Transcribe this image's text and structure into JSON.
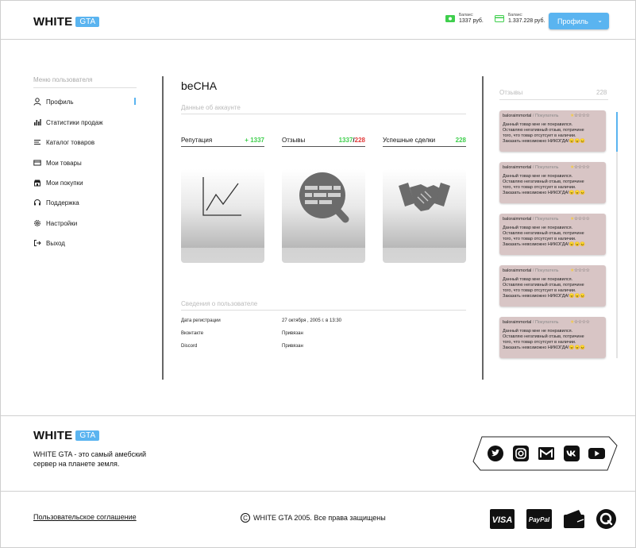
{
  "header": {
    "logo_main": "WHITE",
    "logo_tag": "GTA",
    "balances": [
      {
        "label": "Баланс:",
        "value": "1337 руб.",
        "icon": "cash-icon",
        "color": "#3fcf4d"
      },
      {
        "label": "Баланс:",
        "value": "1.337.228 руб.",
        "icon": "card-icon",
        "color": "#3fcf4d"
      }
    ],
    "profile_button": "Профиль"
  },
  "sidebar": {
    "title": "Меню пользователя",
    "items": [
      {
        "label": "Профиль",
        "icon": "user-icon",
        "active": true
      },
      {
        "label": "Статистики продаж",
        "icon": "bar-chart-icon"
      },
      {
        "label": "Каталог товаров",
        "icon": "list-icon"
      },
      {
        "label": "Мои товары",
        "icon": "card-icon"
      },
      {
        "label": "Мои покупки",
        "icon": "store-icon"
      },
      {
        "label": "Поддержка",
        "icon": "headset-icon"
      },
      {
        "label": "Настройки",
        "icon": "gear-icon"
      },
      {
        "label": "Выход",
        "icon": "logout-icon"
      }
    ]
  },
  "main": {
    "username": "beCHA",
    "account_section": "Данные об аккаунте",
    "stats": {
      "reputation": {
        "label": "Репутация",
        "value": "+ 1337"
      },
      "reviews": {
        "label": "Отзывы",
        "positive": "1337",
        "separator": "/",
        "negative": "228"
      },
      "deals": {
        "label": "Успешные сделки",
        "value": "228"
      }
    },
    "user_section": "Сведения о пользователе",
    "info": [
      {
        "label": "Дата регистрации",
        "value": "27 октября , 2005 г. в 13:30"
      },
      {
        "label": "Вконтакте",
        "value": "Привязан"
      },
      {
        "label": "Discord",
        "value": "Привязан"
      }
    ]
  },
  "reviews": {
    "title": "Отзывы",
    "count": "228",
    "items": [
      {
        "author": "baloraimmortal",
        "role": " / Покупатель",
        "stars": 1,
        "text1": "Данный товар мне не понравился.",
        "text2": "Оставляю негативный отзыв, потричине",
        "text3": "того, что товар отсутсует в наличии.",
        "text4": "Заказать невозможно НИКОГДА!",
        "emoji": "😠😠😠"
      },
      {
        "author": "baloraimmortal",
        "role": " / Покупатель",
        "stars": 1,
        "text1": "Данный товар мне не понравился.",
        "text2": "Оставляю негативный отзыв, потричине",
        "text3": "того, что товар отсутсует в наличии.",
        "text4": "Заказать невозможно НИКОГДА!",
        "emoji": "😠😠😠"
      },
      {
        "author": "baloraimmortal",
        "role": " / Покупатель",
        "stars": 1,
        "text1": "Данный товар мне не понравился.",
        "text2": "Оставляю негативный отзыв, потричине",
        "text3": "того, что товар отсутсует в наличии.",
        "text4": "Заказать невозможно НИКОГДА!",
        "emoji": "😠😠😠"
      },
      {
        "author": "baloraimmortal",
        "role": " / Покупатель",
        "stars": 1,
        "text1": "Данный товар мне не понравился.",
        "text2": "Оставляю негативный отзыв, потричине",
        "text3": "того, что товар отсутсует в наличии.",
        "text4": "Заказать невозможно НИКОГДА!",
        "emoji": "😠😠😠"
      },
      {
        "author": "baloraimmortal",
        "role": " / Покупатель",
        "stars": 1,
        "text1": "Данный товар мне не понравился.",
        "text2": "Оставляю негативный отзыв, потричине",
        "text3": "того, что товар отсутсует в наличии.",
        "text4": "Заказать невозможно НИКОГДА!",
        "emoji": "😠😠😠"
      }
    ]
  },
  "footer": {
    "logo_main": "WHITE",
    "logo_tag": "GTA",
    "description_line1": "WHITE GTA - это самый амебский",
    "description_line2": "сервер на планете земля.",
    "social": [
      "twitter-icon",
      "instagram-icon",
      "gmail-icon",
      "vk-icon",
      "youtube-icon"
    ],
    "agreement": "Пользовательское соглашение",
    "copyright_symbol": "C",
    "copyright": "WHITE GTA 2005. Все права защищены",
    "payments": [
      "visa-icon",
      "paypal-icon",
      "wallet-icon",
      "qiwi-icon"
    ],
    "visa_text": "VISA",
    "paypal_text": "PayPal"
  },
  "colors": {
    "accent": "#5ab4f0",
    "positive": "#3fcf4d",
    "negative": "#e23b3b",
    "review_bg": "#d8c5c5"
  }
}
